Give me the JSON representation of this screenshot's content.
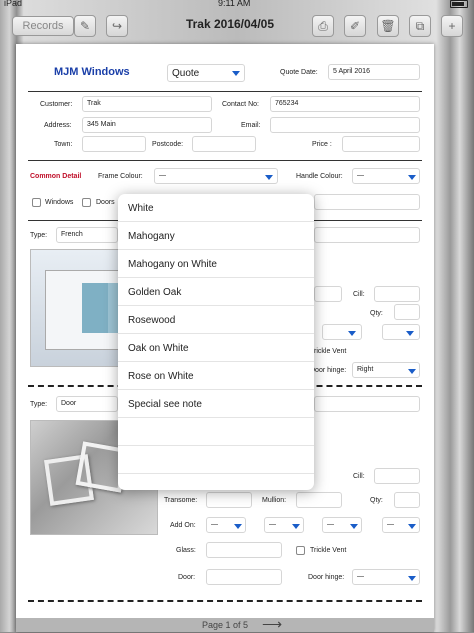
{
  "status": {
    "carrier": "iPad",
    "time": "9:11 AM"
  },
  "toolbar": {
    "records_label": "Records",
    "title": "Trak 2016/04/05"
  },
  "header": {
    "brand": "MJM Windows",
    "doc_type": "Quote",
    "quote_date_label": "Quote Date:",
    "quote_date": "5 April 2016"
  },
  "customer": {
    "customer_label": "Customer:",
    "customer": "Trak",
    "contact_label": "Contact No:",
    "contact": "765234",
    "address_label": "Address:",
    "address": "345 Main",
    "email_label": "Email:",
    "email": "",
    "town_label": "Town:",
    "town": "",
    "postcode_label": "Postcode:",
    "postcode": "",
    "price_label": "Price :",
    "price": ""
  },
  "common": {
    "section_label": "Common Detail",
    "frame_colour_label": "Frame Colour:",
    "frame_colour": "—",
    "handle_colour_label": "Handle Colour:",
    "handle_colour": "—",
    "windows_label": "Windows",
    "doors_label": "Doors"
  },
  "item1": {
    "type_label": "Type:",
    "type": "French",
    "cill_label": "Cill:",
    "qty_label": "Qty:",
    "trickle_label": "Trickle Vent",
    "door_hinge_label": "Door hinge:",
    "door_hinge": "Right"
  },
  "item2": {
    "type_label": "Type:",
    "type": "Door",
    "cill_label": "Cill:",
    "qty_label": "Qty:",
    "transome_label": "Transome:",
    "mullion_label": "Mullion:",
    "add_on_label": "Add On:",
    "add_on_1": "—",
    "add_on_2": "—",
    "add_on_3": "—",
    "add_on_4": "—",
    "glass_label": "Glass:",
    "trickle_label": "Trickle Vent",
    "door_label": "Door:",
    "door_hinge_label": "Door hinge:",
    "door_hinge": "—"
  },
  "popover": {
    "options": [
      "White",
      "Mahogany",
      "Mahogany on White",
      "Golden Oak",
      "Rosewood",
      "Oak on White",
      "Rose on White",
      "Special see note"
    ]
  },
  "footer": {
    "page": "Page 1 of 5",
    "next_arrow": "⟶"
  },
  "colors": {
    "accent": "#1a5dc8",
    "brand": "#1a3fa8",
    "section": "#c0102a"
  }
}
